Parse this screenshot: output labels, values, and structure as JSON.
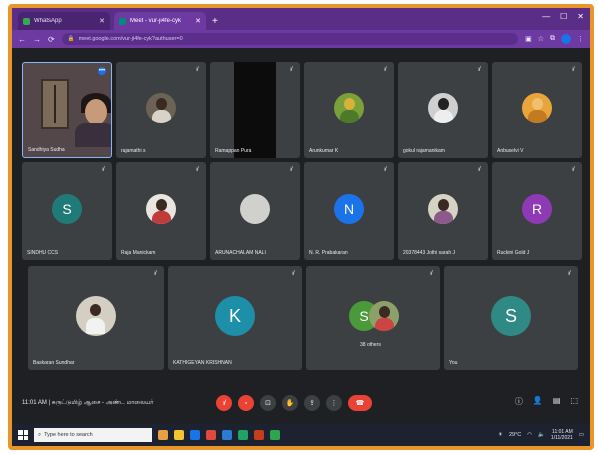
{
  "browser": {
    "tabs": [
      {
        "label": "WhatsApp",
        "active": false
      },
      {
        "label": "Meet - vur-ji4fe-cyk",
        "active": true
      }
    ],
    "address": "meet.google.com/vur-ji4fe-cyk?authuser=0",
    "accent_color": "#6c3aa0"
  },
  "meeting": {
    "participants": [
      {
        "name": "Sandhiya Sudha",
        "type": "video-self"
      },
      {
        "name": "rajamathi s",
        "type": "photo",
        "color": "#9e8b78"
      },
      {
        "name": "Ramappan Pura",
        "type": "black"
      },
      {
        "name": "Arunkumar K",
        "type": "photo",
        "color": "#7aa03a"
      },
      {
        "name": "gokul rajamanikam",
        "type": "photo",
        "color": "#cfcfcf"
      },
      {
        "name": "Anbuselvi V",
        "type": "photo",
        "color": "#e8a63a"
      },
      {
        "name": "SINDHU CCS",
        "type": "initial",
        "initial": "S",
        "color": "#207a78"
      },
      {
        "name": "Raja Manickam",
        "type": "photo",
        "color": "#c23b3b"
      },
      {
        "name": "ARUNACHALAM NALI",
        "type": "photo",
        "color": "#d0d0cc"
      },
      {
        "name": "N. R. Prabakaran",
        "type": "initial",
        "initial": "N",
        "color": "#1a73e8"
      },
      {
        "name": "20378443 Jothi sarah J",
        "type": "photo",
        "color": "#d6d2c4"
      },
      {
        "name": "Ruckini Gold J",
        "type": "initial",
        "initial": "R",
        "color": "#8e3ab5"
      },
      {
        "name": "Baskaran Sundhar",
        "type": "photo",
        "color": "#d4cfc2"
      },
      {
        "name": "KATHIGEYAN KRISHNAN",
        "type": "initial",
        "initial": "K",
        "color": "#1e8fa8"
      },
      {
        "name": "38 others",
        "type": "group",
        "initial": "S",
        "color": "#4a9a3a"
      },
      {
        "name": "You",
        "type": "initial",
        "initial": "S",
        "color": "#2f8a85"
      }
    ],
    "info": "11:01 AM | சுருட்டுமிழ் ஆசை - அண்ட மாலையர்"
  },
  "taskbar": {
    "search_placeholder": "Type here to search",
    "weather": "29°C",
    "time": "11:01 AM",
    "date": "1/11/2021"
  }
}
